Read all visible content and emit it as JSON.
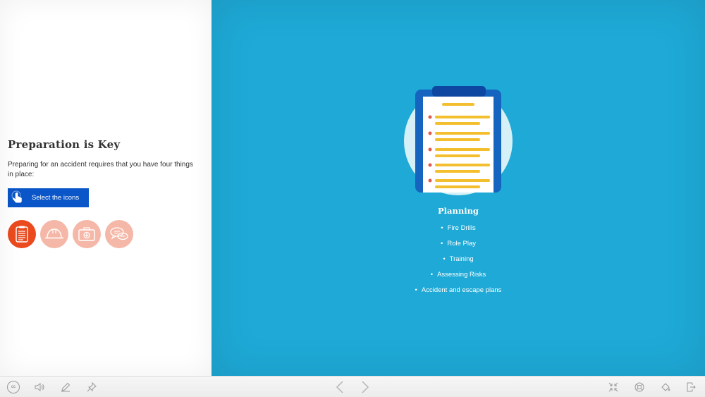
{
  "left": {
    "title": "Preparation is Key",
    "intro": "Preparing for an accident requires that you have four things in place:",
    "select_button": "Select the icons",
    "icons": [
      {
        "name": "planning-clipboard-icon",
        "state": "active"
      },
      {
        "name": "hard-hat-icon",
        "state": "inactive"
      },
      {
        "name": "first-aid-kit-icon",
        "state": "inactive"
      },
      {
        "name": "speech-bubbles-icon",
        "state": "inactive"
      }
    ]
  },
  "right": {
    "heading": "Planning",
    "items": [
      "Fire Drills",
      "Role Play",
      "Training",
      "Assessing Risks",
      "Accident and escape plans"
    ],
    "bullet": "•"
  },
  "toolbar": {
    "cc_label": "cc"
  },
  "colors": {
    "accent_blue": "#0a56c8",
    "panel_blue": "#1ea9d6",
    "icon_active": "#ea4a1e",
    "icon_inactive": "#f5b8a8",
    "clip_yellow": "#f3bf2f"
  }
}
